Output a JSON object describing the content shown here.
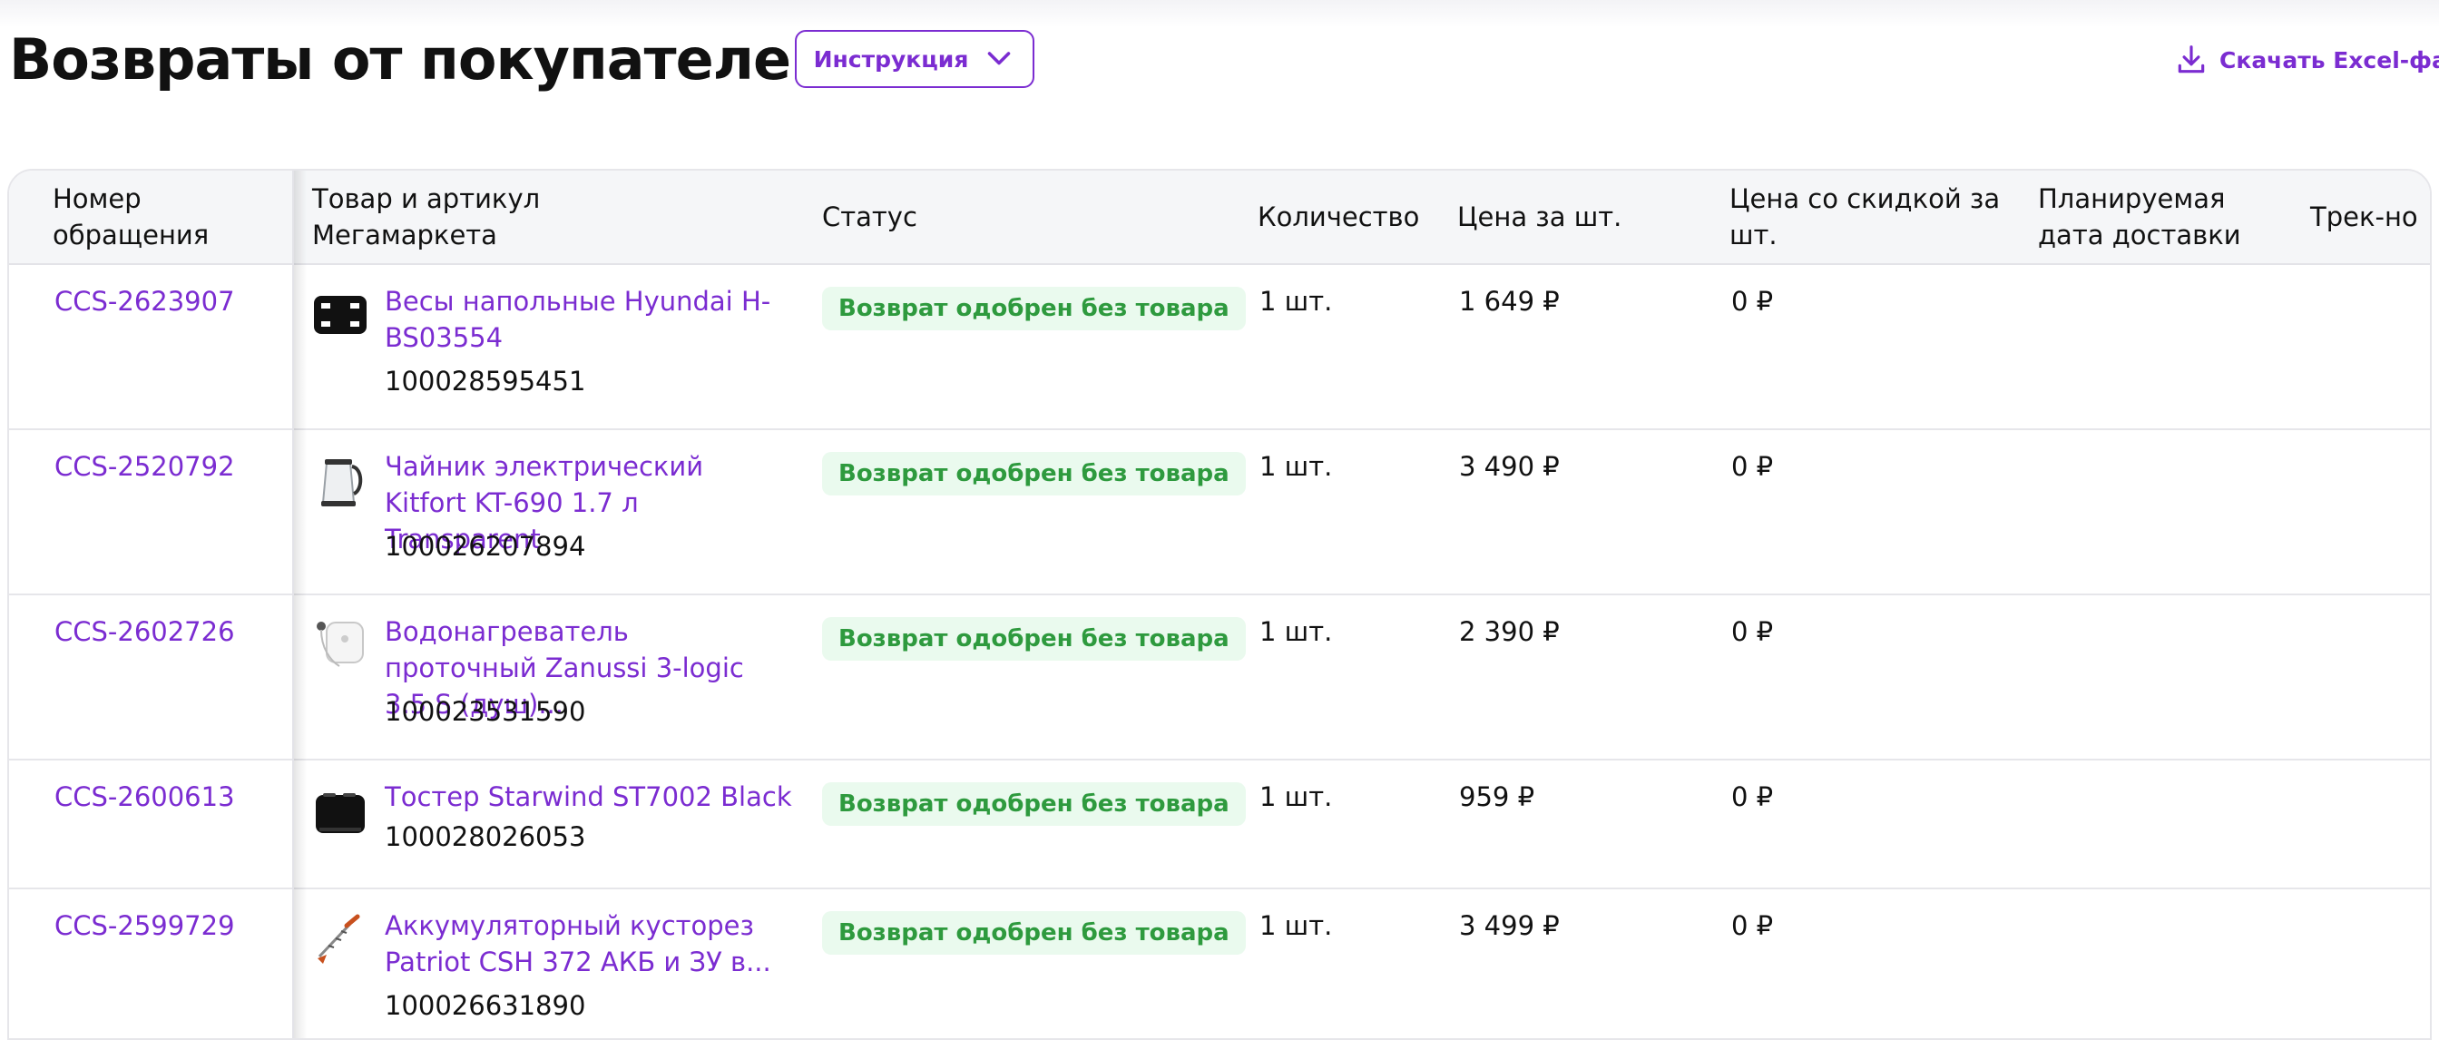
{
  "header": {
    "title": "Возвраты от покупателей",
    "instruction_label": "Инструкция",
    "download_label": "Скачать Excel-файл"
  },
  "columns": [
    "Номер обращения",
    "Товар и артикул Мегамаркета",
    "Статус",
    "Количество",
    "Цена за шт.",
    "Цена со скидкой за шт.",
    "Планируемая дата доставки",
    "Трек-но"
  ],
  "rows": [
    {
      "request": "CCS-2623907",
      "product": "Весы напольные Hyundai H-BS03554",
      "sku": "100028595451",
      "status": "Возврат одобрен без товара",
      "qty": "1 шт.",
      "price": "1 649 ₽",
      "discount_price": "0 ₽",
      "thumb": "scale-icon"
    },
    {
      "request": "CCS-2520792",
      "product": "Чайник электрический Kitfort KT-690 1.7 л Transparent",
      "sku": "100026207894",
      "status": "Возврат одобрен без товара",
      "qty": "1 шт.",
      "price": "3 490 ₽",
      "discount_price": "0 ₽",
      "thumb": "kettle-icon"
    },
    {
      "request": "CCS-2602726",
      "product": "Водонагреватель проточный Zanussi 3-logic 3.5 S (душ)...",
      "sku": "100023531590",
      "status": "Возврат одобрен без товара",
      "qty": "1 шт.",
      "price": "2 390 ₽",
      "discount_price": "0 ₽",
      "thumb": "water-heater-icon"
    },
    {
      "request": "CCS-2600613",
      "product": "Тостер Starwind ST7002 Black",
      "sku": "100028026053",
      "status": "Возврат одобрен без товара",
      "qty": "1 шт.",
      "price": "959 ₽",
      "discount_price": "0 ₽",
      "thumb": "toaster-icon"
    },
    {
      "request": "CCS-2599729",
      "product": "Аккумуляторный кусторез Patriot CSH 372 АКБ и ЗУ в...",
      "sku": "100026631890",
      "status": "Возврат одобрен без товара",
      "qty": "1 шт.",
      "price": "3 499 ₽",
      "discount_price": "0 ₽",
      "thumb": "hedge-trimmer-icon"
    }
  ],
  "colors": {
    "accent": "#7b2cd1",
    "status_text": "#2e9a3e",
    "status_bg": "#eafaee",
    "header_bg": "#f5f6f8"
  }
}
